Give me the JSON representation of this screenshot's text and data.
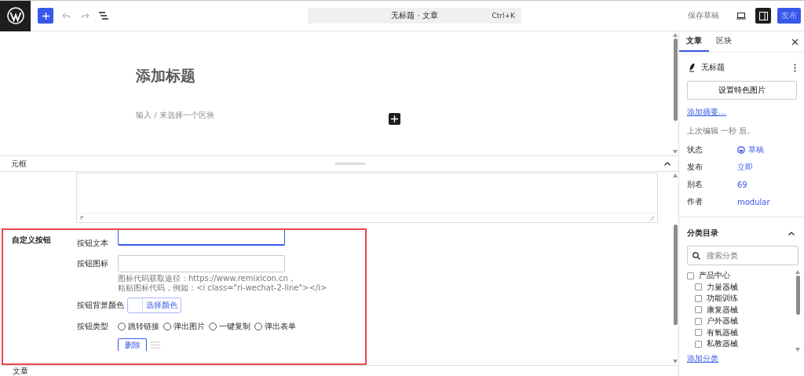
{
  "topbar": {
    "document_title": "无标题 · 文章",
    "shortcut": "Ctrl+K",
    "save_draft": "保存草稿",
    "publish": "发布",
    "sidebar_toggle_on": true
  },
  "editor": {
    "title_placeholder": "添加标题",
    "body_placeholder": "输入 / 来选择一个区块"
  },
  "meta_panel": {
    "title": "元框",
    "expanded": true,
    "textarea_footer": "P",
    "custom_button": {
      "heading": "自定义按钮",
      "text_label": "按钮文本",
      "icon_label": "按钮图标",
      "icon_help": [
        "图标代码获取途径：https://www.remixicon.cn，",
        "粘贴图标代码，例如：<i class=\"ri-wechat-2-line\"></i>"
      ],
      "color_label": "按钮背景颜色",
      "color_button": "选择颜色",
      "type_label": "按钮类型",
      "types": [
        {
          "label": "跳转链接",
          "selected": false
        },
        {
          "label": "弹出图片",
          "selected": false
        },
        {
          "label": "一键复制",
          "selected": false
        },
        {
          "label": "弹出表单",
          "selected": false
        }
      ],
      "delete_button": "删除"
    }
  },
  "status_bar": {
    "breadcrumb": "文章"
  },
  "sidebar": {
    "tabs": [
      {
        "label": "文章",
        "selected": true
      },
      {
        "label": "区块",
        "selected": false
      }
    ],
    "post_title": "无标题",
    "featured_image_button": "设置特色图片",
    "excerpt_link": "添加摘要…",
    "last_edited": "上次编辑 一秒 后。",
    "fields": [
      {
        "label": "状态",
        "value": "草稿",
        "kind": "status"
      },
      {
        "label": "发布",
        "value": "立即",
        "kind": "link"
      },
      {
        "label": "别名",
        "value": "69",
        "kind": "link"
      },
      {
        "label": "作者",
        "value": "modular",
        "kind": "link"
      }
    ],
    "categories": {
      "title": "分类目录",
      "expanded": true,
      "search_placeholder": "搜索分类",
      "items": [
        {
          "label": "产品中心",
          "checked": false,
          "children": [
            {
              "label": "力量器械",
              "checked": false
            },
            {
              "label": "功能训练",
              "checked": false
            },
            {
              "label": "康复器械",
              "checked": false
            },
            {
              "label": "户外器械",
              "checked": false
            },
            {
              "label": "有氧器械",
              "checked": false
            },
            {
              "label": "私教器械",
              "checked": false
            }
          ]
        }
      ],
      "add_link": "添加分类"
    }
  }
}
